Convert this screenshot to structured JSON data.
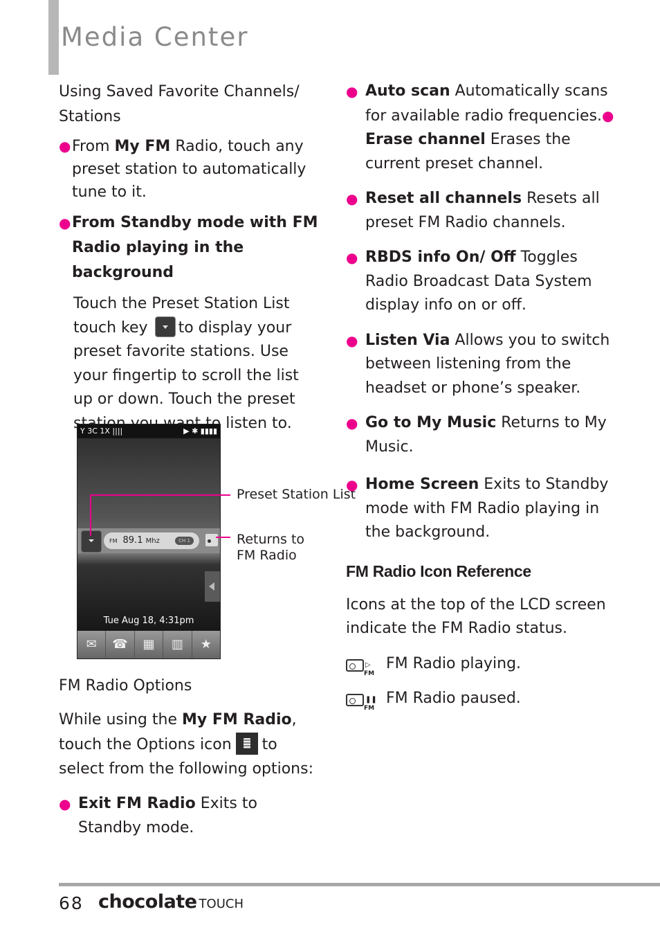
{
  "page": {
    "title": "Media Center",
    "page_number": "68",
    "brand": "chocolate",
    "brand_suffix": "TOUCH",
    "accent_color": "#ec008c",
    "title_color": "#8a8a8a"
  },
  "left": {
    "heading1": "Using Saved Favorite Channels/ Stations",
    "bullet1": {
      "pre": "From ",
      "bold": "My FM",
      "post": " Radio, touch any preset station to automatically tune to it."
    },
    "bullet2": {
      "bold": "From Standby mode with FM Radio playing in the background"
    },
    "para1_a": "Touch the Preset Station List touch key",
    "para1_b": "to display your preset favorite stations. Use your fingertip to scroll the list up or down. Touch the preset station you want to listen to.",
    "heading2": "FM Radio Options",
    "para2_a": "While using the ",
    "para2_bold": "My FM Radio",
    "para2_b": ", touch the Options icon",
    "para2_c": "to select from the following options:",
    "bullet3": {
      "bold": "Exit FM Radio",
      "post": " Exits to Standby mode."
    }
  },
  "phone_screen": {
    "status_left": "Y 3C 1X ||||",
    "status_right": "▶  ✱  ▮▮▮▮",
    "band": "FM",
    "frequency": "89.1",
    "unit": "Mhz",
    "channel": "CH 1",
    "datetime": "Tue Aug 18,  4:31pm",
    "dock": [
      "✉",
      "☎",
      "▦",
      "▥",
      "★"
    ],
    "callouts": {
      "preset": "Preset Station List",
      "returns": "Returns to FM Radio"
    }
  },
  "right": {
    "options": [
      {
        "bold": "Auto scan",
        "text": " Automatically scans for available radio frequencies."
      },
      {
        "bold": "Erase channel",
        "text": " Erases the current preset channel."
      },
      {
        "bold": "Reset all channels",
        "text": " Resets all preset FM Radio channels."
      },
      {
        "bold": "RBDS info On/ Off",
        "text": " Toggles Radio Broadcast Data System display info on or off."
      },
      {
        "bold": "Listen Via",
        "text": " Allows you to switch between listening from the headset or phone’s speaker."
      },
      {
        "bold": "Go to My Music",
        "text": " Returns to My Music."
      },
      {
        "bold": "Home Screen",
        "text": " Exits to Standby mode with FM Radio playing in the background."
      }
    ],
    "icon_heading": "FM Radio Icon Reference",
    "icon_para": "Icons at the top of the LCD screen indicate the FM Radio status.",
    "icons": [
      {
        "name": "fm-playing",
        "label": "FM Radio playing.",
        "state_glyph": "▷"
      },
      {
        "name": "fm-paused",
        "label": "FM Radio paused.",
        "state_glyph": "❚❚"
      }
    ]
  }
}
